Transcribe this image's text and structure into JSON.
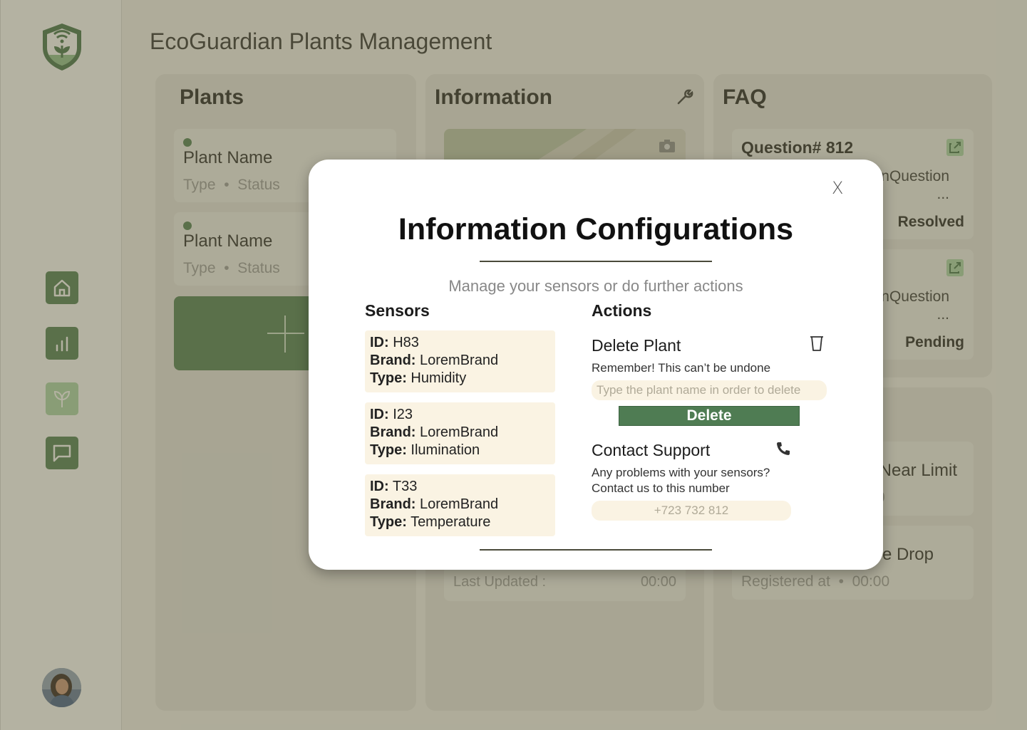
{
  "app": {
    "title": "EcoGuardian Plants Management"
  },
  "panels": {
    "plants": {
      "title": "Plants",
      "cards": [
        {
          "name": "Plant Name",
          "type": "Type",
          "status": "Status"
        },
        {
          "name": "Plant Name",
          "type": "Type",
          "status": "Status"
        }
      ]
    },
    "information": {
      "title": "Information",
      "last_updated_label": "Last Updated :",
      "last_updated_value": "00:00"
    },
    "faq": {
      "title": "FAQ",
      "questions": [
        {
          "title": "Question# 812",
          "body_visible": "nQuestion",
          "ellipsis": "...",
          "status": "Resolved"
        },
        {
          "title": "",
          "body_visible": "nQuestion",
          "ellipsis": "...",
          "status": "Pending"
        }
      ]
    },
    "alerts": {
      "items": [
        {
          "title_visible": "Near Limit",
          "meta_visible": "0"
        },
        {
          "title_visible": "e Drop",
          "registered_label": "Registered at",
          "registered_value": "00:00"
        }
      ]
    }
  },
  "modal": {
    "close_label": "X",
    "title": "Information Configurations",
    "subtitle": "Manage your sensors or do further actions",
    "sensors_heading": "Sensors",
    "actions_heading": "Actions",
    "sensors": [
      {
        "id_label": "ID:",
        "id": "H83",
        "brand_label": "Brand:",
        "brand": "LoremBrand",
        "type_label": "Type:",
        "type": "Humidity"
      },
      {
        "id_label": "ID:",
        "id": "I23",
        "brand_label": "Brand:",
        "brand": "LoremBrand",
        "type_label": "Type:",
        "type": "Ilumination"
      },
      {
        "id_label": "ID:",
        "id": "T33",
        "brand_label": "Brand:",
        "brand": "LoremBrand",
        "type_label": "Type:",
        "type": "Temperature"
      }
    ],
    "delete": {
      "title": "Delete Plant",
      "warning": "Remember! This can’t be undone",
      "placeholder": "Type the plant name in order to delete",
      "button_label": "Delete"
    },
    "support": {
      "title": "Contact Support",
      "line1": "Any problems with your sensors?",
      "line2": "Contact us to this number",
      "phone": "+723 732 812"
    }
  },
  "colors": {
    "accent": "#4a7a4e",
    "accent_light": "#a9d4a6",
    "cream": "#faf3e3"
  }
}
